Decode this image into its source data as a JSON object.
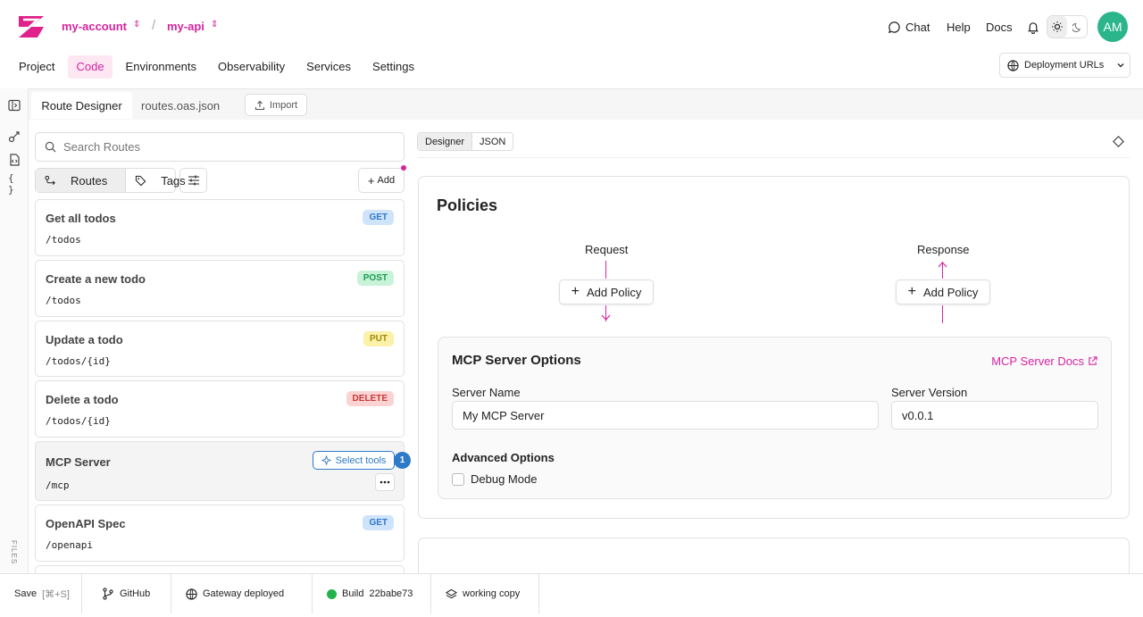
{
  "header": {
    "account": "my-account",
    "project": "my-api",
    "separator": "/",
    "chat_label": "Chat",
    "help_label": "Help",
    "docs_label": "Docs",
    "avatar_initials": "AM"
  },
  "nav": {
    "tabs": [
      "Project",
      "Code",
      "Environments",
      "Observability",
      "Services",
      "Settings"
    ],
    "active": "Code",
    "deployment_urls": "Deployment URLs"
  },
  "sidebar": {
    "files_label": "FILES"
  },
  "editor_tabs": {
    "tabs": [
      "Route Designer",
      "routes.oas.json"
    ],
    "active": "Route Designer",
    "import_label": "Import"
  },
  "routes_panel": {
    "search_placeholder": "Search Routes",
    "routes_tab": "Routes",
    "tags_tab": "Tags",
    "add_label": "Add",
    "routes": [
      {
        "name": "Get all todos",
        "path": "/todos",
        "method": "GET"
      },
      {
        "name": "Create a new todo",
        "path": "/todos",
        "method": "POST"
      },
      {
        "name": "Update a todo",
        "path": "/todos/{id}",
        "method": "PUT"
      },
      {
        "name": "Delete a todo",
        "path": "/todos/{id}",
        "method": "DELETE"
      },
      {
        "name": "MCP Server",
        "path": "/mcp",
        "select_tools": "Select tools",
        "tools_count": "1"
      },
      {
        "name": "OpenAPI Spec",
        "path": "/openapi",
        "method": "GET"
      }
    ]
  },
  "view_toggle": {
    "designer": "Designer",
    "json": "JSON"
  },
  "policies": {
    "title": "Policies",
    "request_label": "Request",
    "response_label": "Response",
    "add_policy": "Add Policy"
  },
  "mcp_options": {
    "title": "MCP Server Options",
    "docs_link": "MCP Server Docs",
    "server_name_label": "Server Name",
    "server_name_value": "My MCP Server",
    "server_version_label": "Server Version",
    "server_version_value": "v0.0.1",
    "advanced_label": "Advanced Options",
    "debug_label": "Debug Mode"
  },
  "statusbar": {
    "save": "Save",
    "save_shortcut": "[⌘+S]",
    "github": "GitHub",
    "gateway": "Gateway deployed",
    "build_label": "Build",
    "build_id": "22babe73",
    "working_copy": "working copy"
  },
  "colors": {
    "brand": "#d6249f",
    "accent_blue": "#2f79c9",
    "avatar": "#2bb58a"
  }
}
